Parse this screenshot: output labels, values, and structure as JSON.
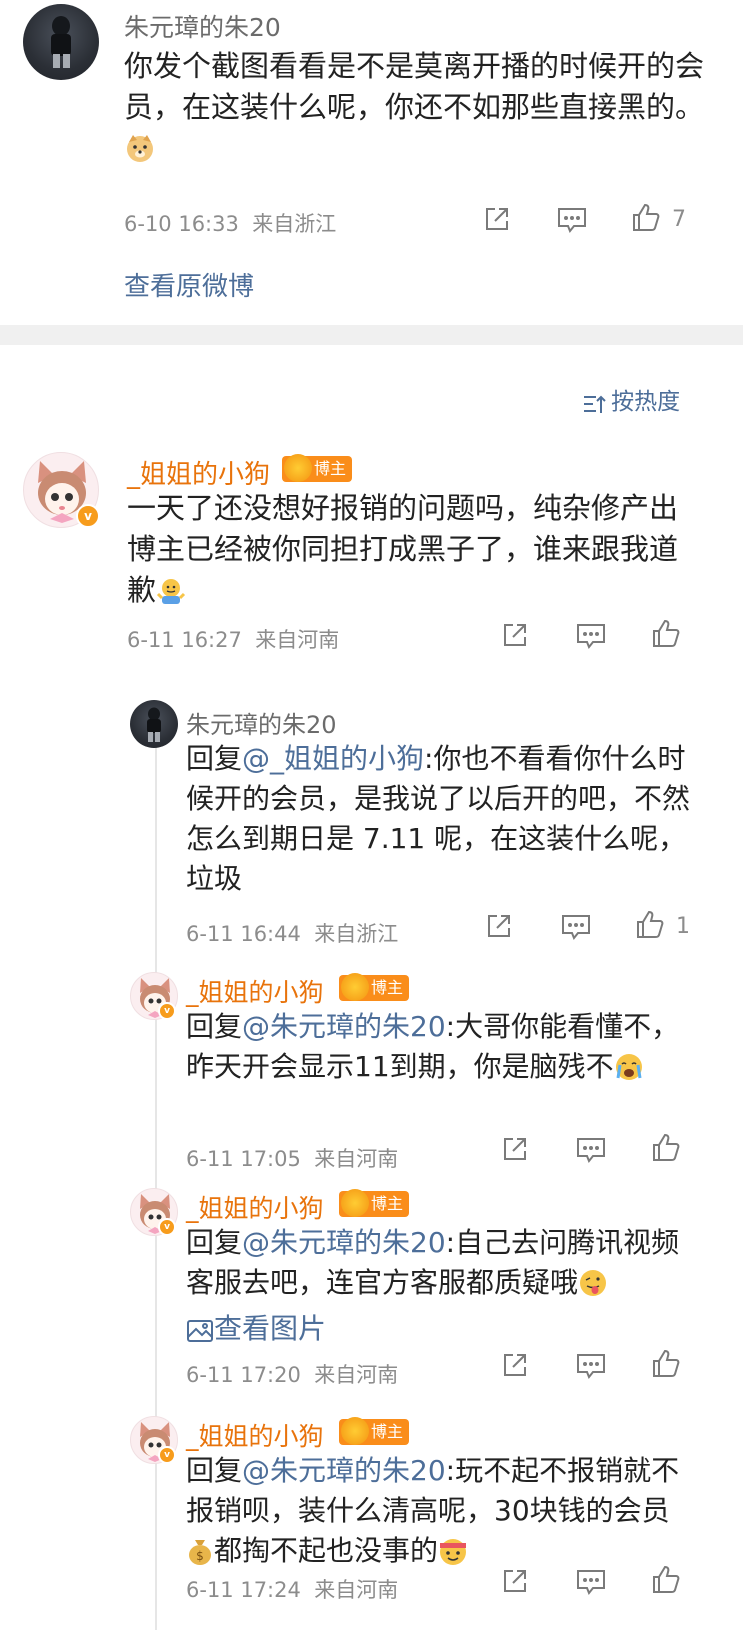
{
  "top_comment": {
    "user": "朱元璋的朱20",
    "text": "你发个截图看看是不是莫离开播的时候开的会员，在这装什么呢，你还不如那些直接黑的。",
    "time": "6-10 16:33",
    "location": "来自浙江",
    "likes": "7",
    "view_original": "查看原微博"
  },
  "sort": {
    "label": "按热度"
  },
  "thread": {
    "main": {
      "user": "_姐姐的小狗",
      "badge": "博主",
      "text": "一天了还没想好报销的问题吗，纯杂修产出博主已经被你同担打成黑子了，谁来跟我道歉",
      "time": "6-11 16:27",
      "location": "来自河南"
    },
    "replies": [
      {
        "user": "朱元璋的朱20",
        "reply_prefix": "回复",
        "mention": "@_姐姐的小狗",
        "text": ":你也不看看你什么时候开的会员，是我说了以后开的吧，不然怎么到期日是 7.11 呢，在这装什么呢，垃圾",
        "time": "6-11 16:44",
        "location": "来自浙江",
        "likes": "1"
      },
      {
        "user": "_姐姐的小狗",
        "badge": "博主",
        "reply_prefix": "回复",
        "mention": "@朱元璋的朱20",
        "text": ":大哥你能看懂不，昨天开会显示11到期，你是脑残不",
        "time": "6-11 17:05",
        "location": "来自河南"
      },
      {
        "user": "_姐姐的小狗",
        "badge": "博主",
        "reply_prefix": "回复",
        "mention": "@朱元璋的朱20",
        "text": ":自己去问腾讯视频客服去吧，连官方客服都质疑哦",
        "view_image": "查看图片",
        "time": "6-11 17:20",
        "location": "来自河南"
      },
      {
        "user": "_姐姐的小狗",
        "badge": "博主",
        "reply_prefix": "回复",
        "mention": "@朱元璋的朱20",
        "text_a": ":玩不起不报销就不报销呗，装什么清高呢，30块钱的会员",
        "text_b": "都掏不起也没事的",
        "time": "6-11 17:24",
        "location": "来自河南"
      }
    ]
  },
  "icons": [
    "share-icon",
    "comment-icon",
    "like-icon",
    "sort-icon",
    "image-icon"
  ],
  "colors": {
    "link": "#4d6e99",
    "orange_name": "#e8730b",
    "badge": "#fa8d1a",
    "meta": "#8c8c8c"
  }
}
